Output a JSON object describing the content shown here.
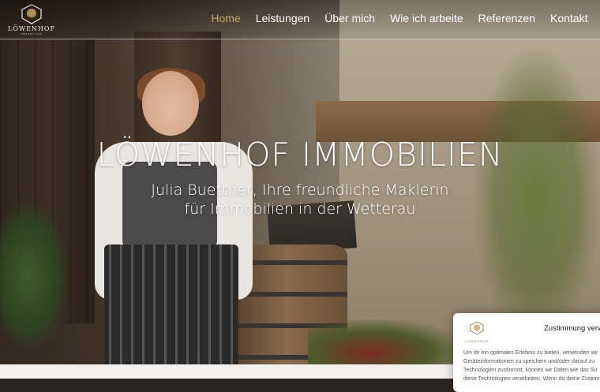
{
  "header": {
    "logo": {
      "text": "LÖWENHOF",
      "subtext": "IMMOBILIEN",
      "icon": "lion-crest-icon"
    },
    "nav": [
      {
        "label": "Home",
        "active": true
      },
      {
        "label": "Leistungen",
        "active": false
      },
      {
        "label": "Über mich",
        "active": false
      },
      {
        "label": "Wie ich arbeite",
        "active": false
      },
      {
        "label": "Referenzen",
        "active": false
      },
      {
        "label": "Kontakt",
        "active": false
      }
    ],
    "active_color": "#c9a564"
  },
  "hero": {
    "title": "LÖWENHOF IMMOBILIEN",
    "subtitle_line1": "Julia Buettner, Ihre freundliche Maklerin",
    "subtitle_line2": "für Immobilien in der Wetterau"
  },
  "cookie_banner": {
    "title": "Zustimmung verw",
    "body_lines": [
      "Um dir ein optimales Erlebnis zu bieten, verwenden wir",
      "Geräteinformationen zu speichern und/oder darauf zu",
      "Technologien zustimmst, können wir Daten wie das Su",
      "diese Technologien verarbeiten. Wenn du deine Zustimm"
    ]
  }
}
